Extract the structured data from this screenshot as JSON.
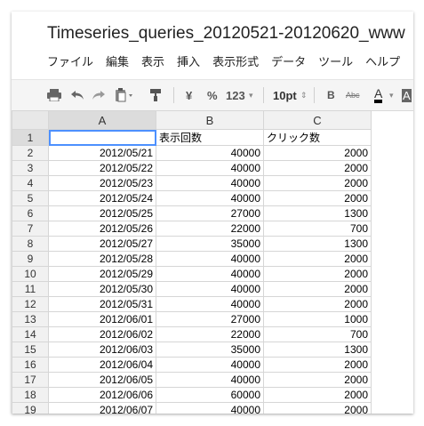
{
  "document": {
    "title": "Timeseries_queries_20120521-20120620_www"
  },
  "menu": [
    "ファイル",
    "編集",
    "表示",
    "挿入",
    "表示形式",
    "データ",
    "ツール",
    "ヘルプ"
  ],
  "toolbar": {
    "currency": "¥",
    "percent": "%",
    "number_format": "123",
    "font_size": "10pt",
    "bold": "B",
    "strikethrough": "Abc",
    "text_color": "A",
    "bg_color": "A"
  },
  "sheet": {
    "columns": [
      "A",
      "B",
      "C"
    ],
    "rows": [
      {
        "n": "1",
        "a": "",
        "b": "表示回数",
        "c": "クリック数"
      },
      {
        "n": "2",
        "a": "2012/05/21",
        "b": "40000",
        "c": "2000"
      },
      {
        "n": "3",
        "a": "2012/05/22",
        "b": "40000",
        "c": "2000"
      },
      {
        "n": "4",
        "a": "2012/05/23",
        "b": "40000",
        "c": "2000"
      },
      {
        "n": "5",
        "a": "2012/05/24",
        "b": "40000",
        "c": "2000"
      },
      {
        "n": "6",
        "a": "2012/05/25",
        "b": "27000",
        "c": "1300"
      },
      {
        "n": "7",
        "a": "2012/05/26",
        "b": "22000",
        "c": "700"
      },
      {
        "n": "8",
        "a": "2012/05/27",
        "b": "35000",
        "c": "1300"
      },
      {
        "n": "9",
        "a": "2012/05/28",
        "b": "40000",
        "c": "2000"
      },
      {
        "n": "10",
        "a": "2012/05/29",
        "b": "40000",
        "c": "2000"
      },
      {
        "n": "11",
        "a": "2012/05/30",
        "b": "40000",
        "c": "2000"
      },
      {
        "n": "12",
        "a": "2012/05/31",
        "b": "40000",
        "c": "2000"
      },
      {
        "n": "13",
        "a": "2012/06/01",
        "b": "27000",
        "c": "1000"
      },
      {
        "n": "14",
        "a": "2012/06/02",
        "b": "22000",
        "c": "700"
      },
      {
        "n": "15",
        "a": "2012/06/03",
        "b": "35000",
        "c": "1300"
      },
      {
        "n": "16",
        "a": "2012/06/04",
        "b": "40000",
        "c": "2000"
      },
      {
        "n": "17",
        "a": "2012/06/05",
        "b": "40000",
        "c": "2000"
      },
      {
        "n": "18",
        "a": "2012/06/06",
        "b": "60000",
        "c": "2000"
      },
      {
        "n": "19",
        "a": "2012/06/07",
        "b": "40000",
        "c": "2000"
      }
    ]
  }
}
